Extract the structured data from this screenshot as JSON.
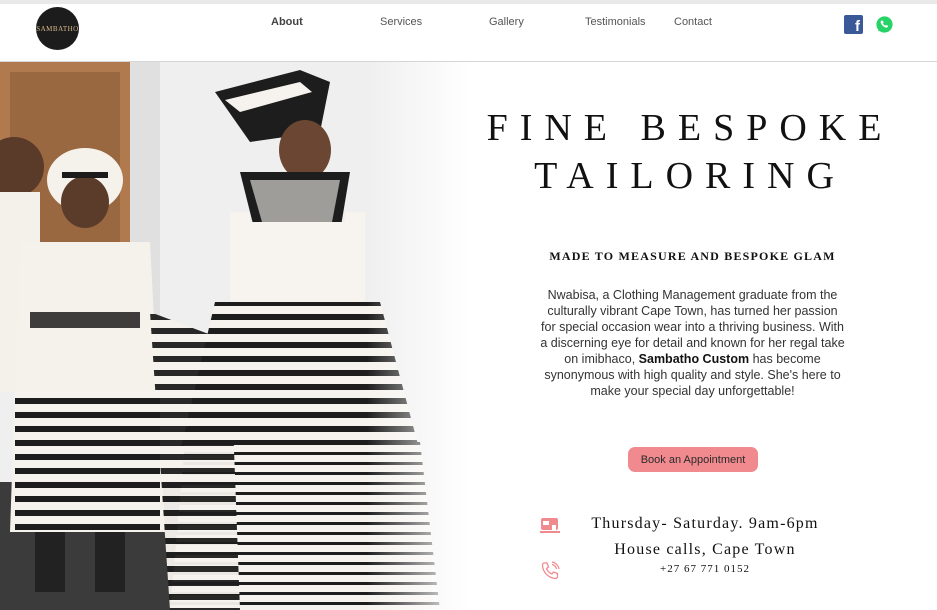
{
  "brand": {
    "logo_text": "SAMBATHO"
  },
  "nav": {
    "items": [
      {
        "label": "About"
      },
      {
        "label": "Services"
      },
      {
        "label": "Gallery"
      },
      {
        "label": "Testimonials"
      },
      {
        "label": "Contact"
      }
    ]
  },
  "social": {
    "facebook_glyph": "f"
  },
  "hero": {
    "title_line1": "FINE BESPOKE",
    "title_line2": "TAILORING",
    "subtitle": "MADE TO MEASURE AND BESPOKE GLAM",
    "paragraph_part1": "Nwabisa, a Clothing Management graduate from the culturally vibrant Cape Town, has turned her passion for special occasion wear into a thriving business. With a discerning eye for detail and known for her regal take on imibhaco,",
    "paragraph_brand": "Sambatho Custom",
    "paragraph_part2": "has become synonymous with high quality and style. She's here to make your special day unforgettable!",
    "cta_label": "Book an Appointment",
    "hours": "Thursday- Saturday. 9am-6pm",
    "location": "House calls, Cape Town",
    "phone": "+27 67 771 0152"
  },
  "colors": {
    "accent": "#f08a8f",
    "facebook": "#3b5998",
    "whatsapp": "#25d366",
    "dark": "#111111"
  },
  "icons": [
    "facebook-icon",
    "whatsapp-icon",
    "sewing-machine-icon",
    "phone-icon"
  ]
}
